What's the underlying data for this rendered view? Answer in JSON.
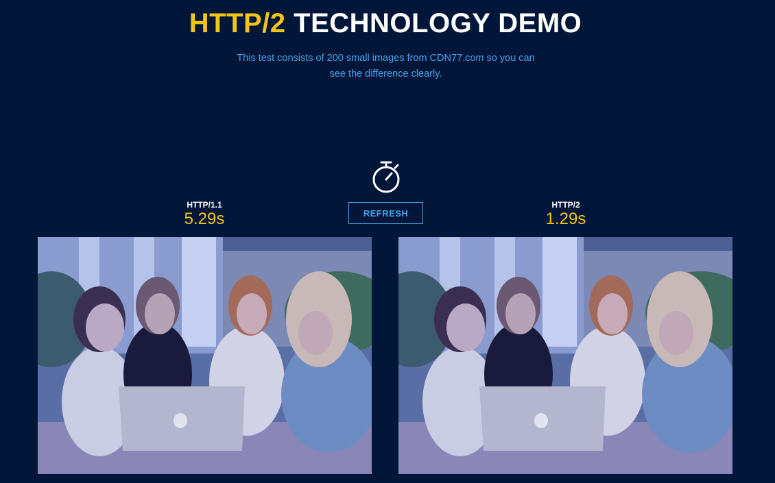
{
  "header": {
    "title_accent": "HTTP/2",
    "title_rest": " TECHNOLOGY DEMO",
    "subtitle": "This test consists of 200 small images from CDN77.com so you can see the difference clearly."
  },
  "controls": {
    "refresh_label": "REFRESH",
    "timer_icon": "stopwatch-icon"
  },
  "results": {
    "http1": {
      "label": "HTTP/1.1",
      "time": "5.29s"
    },
    "http2": {
      "label": "HTTP/2",
      "time": "1.29s"
    }
  },
  "images": {
    "left": "Four women looking at a laptop (HTTP/1.1)",
    "right": "Four women looking at a laptop (HTTP/2)"
  },
  "colors": {
    "background": "#02163a",
    "accent_yellow": "#f3c615",
    "accent_blue": "#4aa2e6",
    "text_white": "#ffffff"
  }
}
